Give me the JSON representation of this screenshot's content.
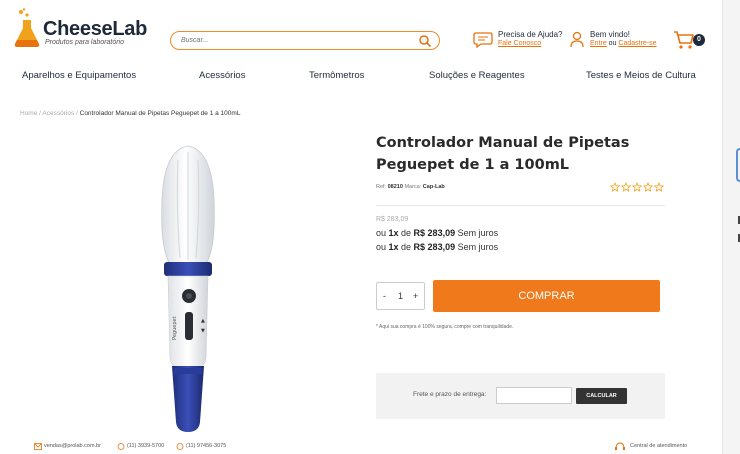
{
  "brand": {
    "name": "CheeseLab",
    "tagline": "Produtos para laboratório",
    "accent": "#f07a1b"
  },
  "search": {
    "placeholder": "Buscar..."
  },
  "help": {
    "title": "Precisa de Ajuda?",
    "link": "Fale Conosco"
  },
  "account": {
    "welcome": "Bem vindo!",
    "login": "Entre",
    "separator": " ou ",
    "register": "Cadastre-se"
  },
  "cart": {
    "count": "0"
  },
  "nav": [
    {
      "label": "Aparelhos e Equipamentos"
    },
    {
      "label": "Acessórios"
    },
    {
      "label": "Termômetros"
    },
    {
      "label": "Soluções e Reagentes"
    },
    {
      "label": "Testes e Meios de Cultura"
    }
  ],
  "breadcrumb": {
    "home": "Home",
    "category": "Acessórios",
    "sep": " / ",
    "current": "Controlador Manual de Pipetas Peguepet de 1 a 100mL"
  },
  "product": {
    "title": "Controlador Manual de Pipetas Peguepet de 1 a 100mL",
    "ref_label": "Ref:",
    "ref": "08210",
    "brand_label": "Marca:",
    "brand": "Cap-Lab",
    "rating": 0,
    "old_price": "R$ 283,09",
    "installments": [
      {
        "prefix": "ou ",
        "times": "1x",
        "mid": " de ",
        "price": "R$ 283,09",
        "suffix": " Sem juros"
      },
      {
        "prefix": "ou ",
        "times": "1x",
        "mid": " de ",
        "price": "R$ 283,09",
        "suffix": " Sem juros"
      }
    ],
    "quantity": {
      "minus": "-",
      "value": "1",
      "plus": "+"
    },
    "buy_label": "COMPRAR",
    "safe_note": "* Aqui sua compra é 100% segura, compre com tranquilidade.",
    "shipping": {
      "label": "Frete e prazo de entrega:",
      "button": "CALCULAR"
    }
  },
  "footer": {
    "email": "vendas@prolab.com.br",
    "phone": "(11) 3939-5700",
    "whatsapp": "(11) 97456-3075",
    "support": "Central de atendimento"
  }
}
